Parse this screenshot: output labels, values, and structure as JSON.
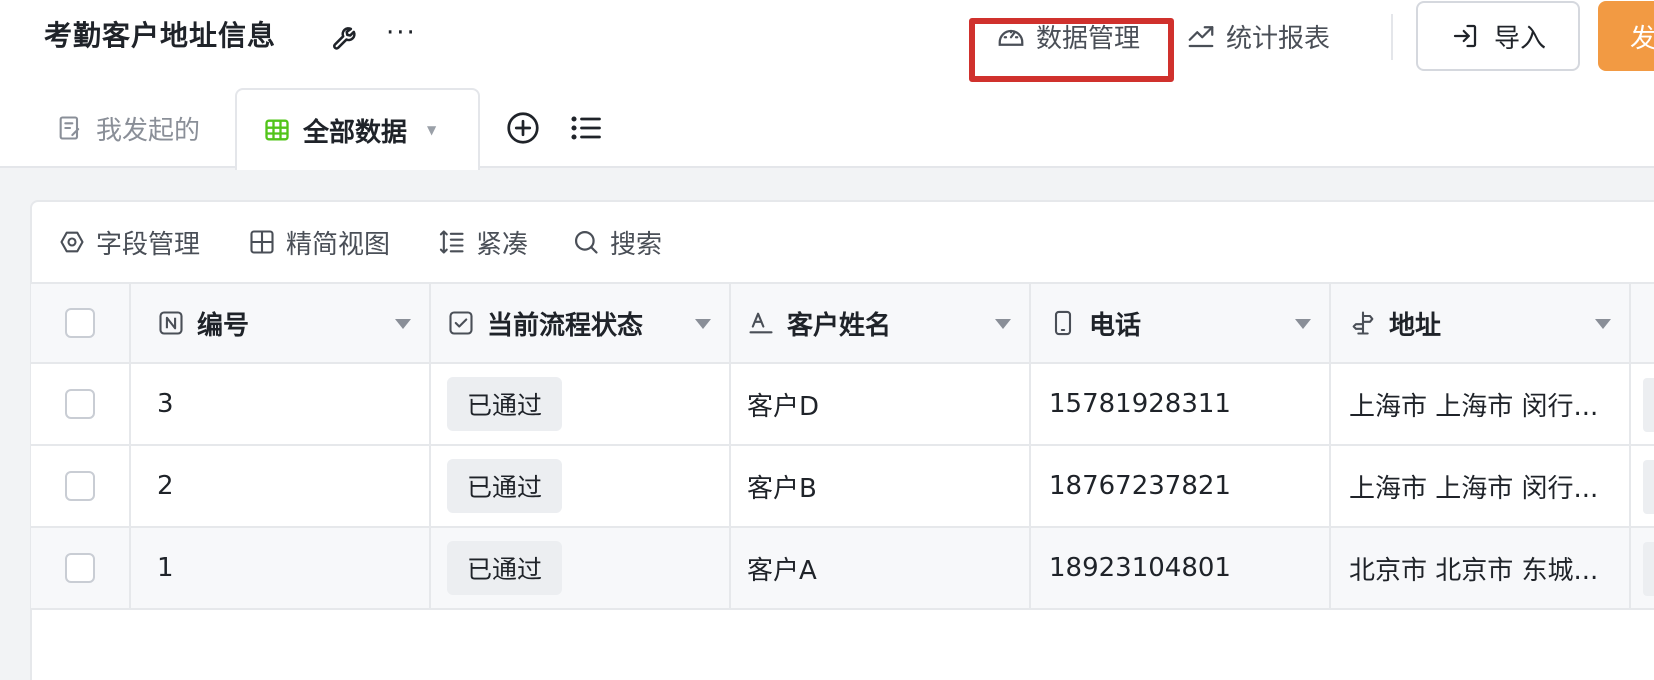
{
  "header": {
    "title": "考勤客户地址信息",
    "more": "···",
    "actions": {
      "data_manage": "数据管理",
      "stats_report": "统计报表",
      "import": "导入",
      "publish": "发"
    }
  },
  "tabs": {
    "mine": "我发起的",
    "all": "全部数据"
  },
  "toolbar": {
    "fields": "字段管理",
    "simple_view": "精简视图",
    "compact": "紧凑",
    "search": "搜索"
  },
  "table": {
    "columns": [
      "编号",
      "当前流程状态",
      "客户姓名",
      "电话",
      "地址"
    ],
    "rows": [
      {
        "id": "3",
        "status": "已通过",
        "name": "客户D",
        "phone": "15781928311",
        "address": "上海市 上海市 闵行..."
      },
      {
        "id": "2",
        "status": "已通过",
        "name": "客户B",
        "phone": "18767237821",
        "address": "上海市 上海市 闵行..."
      },
      {
        "id": "1",
        "status": "已通过",
        "name": "客户A",
        "phone": "18923104801",
        "address": "北京市 北京市 东城..."
      }
    ]
  },
  "colors": {
    "highlight": "#d0312d",
    "publish_button": "#f29a43",
    "grid_icon": "#52c41a"
  }
}
